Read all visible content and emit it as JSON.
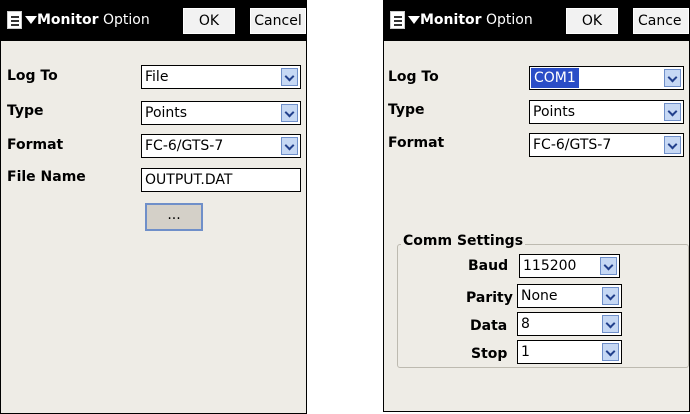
{
  "left": {
    "title_bold": "Monitor",
    "title_rest": " Option",
    "ok_label": "OK",
    "cancel_label": "Cancel",
    "fields": {
      "log_to": {
        "label": "Log To",
        "value": "File"
      },
      "type": {
        "label": "Type",
        "value": "Points"
      },
      "format": {
        "label": "Format",
        "value": "FC-6/GTS-7"
      },
      "file_name": {
        "label": "File Name",
        "value": "OUTPUT.DAT"
      }
    },
    "browse_label": "..."
  },
  "right": {
    "title_bold": "Monitor",
    "title_rest": " Option",
    "ok_label": "OK",
    "cancel_label": "Cance",
    "fields": {
      "log_to": {
        "label": "Log To",
        "value": "COM1"
      },
      "type": {
        "label": "Type",
        "value": "Points"
      },
      "format": {
        "label": "Format",
        "value": "FC-6/GTS-7"
      }
    },
    "comm_settings": {
      "title": "Comm Settings",
      "baud": {
        "label": "Baud",
        "value": "115200"
      },
      "parity": {
        "label": "Parity",
        "value": "None"
      },
      "data": {
        "label": "Data",
        "value": "8"
      },
      "stop": {
        "label": "Stop",
        "value": "1"
      }
    }
  },
  "colors": {
    "titlebar": "#000000",
    "selection": "#2a4dc7",
    "dropdown_button": "#c6d8f4",
    "dialog_background": "#eeece6"
  },
  "icons": [
    "start-menu-icon",
    "dropdown-arrow-icon"
  ]
}
